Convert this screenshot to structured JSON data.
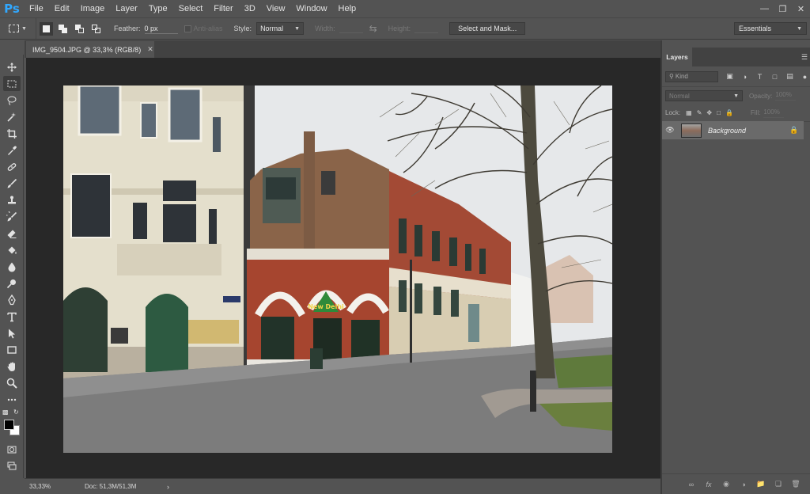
{
  "app": {
    "logo": "Ps",
    "menu": [
      "File",
      "Edit",
      "Image",
      "Layer",
      "Type",
      "Select",
      "Filter",
      "3D",
      "View",
      "Window",
      "Help"
    ],
    "window_controls": [
      "minimize",
      "restore",
      "close"
    ]
  },
  "options_bar": {
    "feather_label": "Feather:",
    "feather_value": "0 px",
    "antialias_label": "Anti-alias",
    "style_label": "Style:",
    "style_value": "Normal",
    "width_label": "Width:",
    "height_label": "Height:",
    "select_mask_label": "Select and Mask...",
    "workspace_value": "Essentials"
  },
  "document": {
    "tab_title": "IMG_9504.JPG @ 33,3% (RGB/8)",
    "zoom": "33,33%",
    "doc_size": "Doc: 51,3M/51,3M",
    "signage": "New Delhi"
  },
  "tools": [
    "move-tool",
    "rectangular-marquee-tool",
    "lasso-tool",
    "quick-selection-tool",
    "crop-tool",
    "eyedropper-tool",
    "spot-healing-tool",
    "brush-tool",
    "clone-stamp-tool",
    "history-brush-tool",
    "eraser-tool",
    "paint-bucket-tool",
    "blur-tool",
    "dodge-tool",
    "pen-tool",
    "type-tool",
    "path-selection-tool",
    "rectangle-tool",
    "hand-tool",
    "zoom-tool",
    "edit-toolbar"
  ],
  "colors": {
    "foreground": "#000000",
    "background": "#ffffff",
    "accent": "#31a8ff"
  },
  "layers_panel": {
    "tab_label": "Layers",
    "kind_label": "Kind",
    "blend_mode": "Normal",
    "opacity_label": "Opacity:",
    "opacity_value": "100%",
    "lock_label": "Lock:",
    "fill_label": "Fill:",
    "fill_value": "100%",
    "layers": [
      {
        "name": "Background",
        "visible": true,
        "locked": true
      }
    ]
  }
}
